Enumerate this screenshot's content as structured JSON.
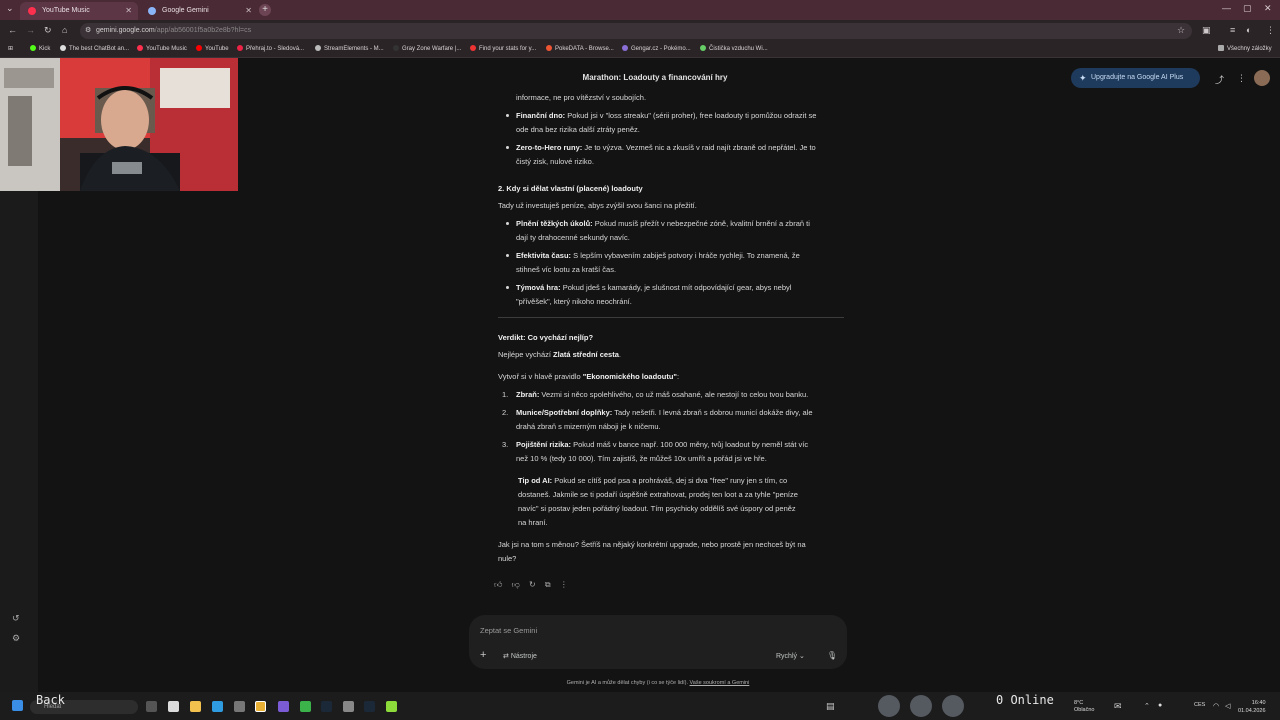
{
  "tabs": [
    {
      "label": "YouTube Music",
      "active": true
    },
    {
      "label": "Google Gemini",
      "active": false
    }
  ],
  "address": {
    "domain": "gemini.google.com",
    "path": "/app/ab56001f5a0b2e8b?hl=cs"
  },
  "bookmarks": [
    {
      "label": "Kick"
    },
    {
      "label": "The best ChatBot an..."
    },
    {
      "label": "YouTube Music"
    },
    {
      "label": "YouTube"
    },
    {
      "label": "Přehraj.to - Sledová..."
    },
    {
      "label": "StreamElements - M..."
    },
    {
      "label": "Gray Zone Warfare |..."
    },
    {
      "label": "Find your stats for y..."
    },
    {
      "label": "PokeDATA - Browse..."
    },
    {
      "label": "Gengar.cz - Pokémo..."
    },
    {
      "label": "Čistička vzduchu Wi..."
    }
  ],
  "bookmarks_all": "Všechny záložky",
  "header": {
    "title": "Marathon: Loadouty a financování hry",
    "upgrade_label": "Upgradujte na Google AI Plus"
  },
  "content": {
    "line_intro": "informace, ne pro vítězství v soubojích.",
    "b1_term": "Finanční dno:",
    "b1_text": " Pokud jsi v \"loss streaku\" (sérii proher), free loadouty ti pomůžou odrazit se",
    "b1_text2": "ode dna bez rizika další ztráty peněz.",
    "b2_term": "Zero-to-Hero runy:",
    "b2_text": " Je to výzva. Vezmeš nic a zkusíš v raid najít zbraně od nepřátel. Je to",
    "b2_text2": "čistý zisk, nulové riziko.",
    "h2": "2. Kdy si dělat vlastní (placené) loadouty",
    "h2_intro": "Tady už investuješ peníze, abys zvýšil svou šanci na přežití.",
    "b3_term": "Plnění těžkých úkolů:",
    "b3_text": " Pokud musíš přežít v nebezpečné zóně, kvalitní brnění a zbraň ti",
    "b3_text2": "dají ty drahocenné sekundy navíc.",
    "b4_term": "Efektivita času:",
    "b4_text": " S lepším vybavením zabiješ potvory i hráče rychleji. To znamená, že",
    "b4_text2": "stihneš víc lootu za kratší čas.",
    "b5_term": "Týmová hra:",
    "b5_text": " Pokud jdeš s kamarády, je slušnost mít odpovídající gear, abys nebyl",
    "b5_text2": "\"přívěšek\", který nikoho neochrání.",
    "verdict_title": "Verdikt: Co vychází nejlíp?",
    "verdict_pre": "Nejlépe vychází ",
    "verdict_bold": "Zlatá střední cesta",
    "verdict_post": ".",
    "rule_pre": "Vytvoř si v hlavě pravidlo ",
    "rule_bold": "\"Ekonomického loadoutu\"",
    "rule_post": ":",
    "n1_num": "1.",
    "n1_term": "Zbraň:",
    "n1_text": " Vezmi si něco spolehlivého, co už máš osahané, ale nestojí to celou tvou banku.",
    "n2_num": "2.",
    "n2_term": "Munice/Spotřební doplňky:",
    "n2_text": " Tady nešetři. I levná zbraň s dobrou municí dokáže divy, ale",
    "n2_text2": "drahá zbraň s mizerným náboji je k ničemu.",
    "n3_num": "3.",
    "n3_term": "Pojištění rizika:",
    "n3_text": " Pokud máš v bance např. 100 000 měny, tvůj loadout by neměl stát víc",
    "n3_text2": "než 10 % (tedy 10 000). Tím zajistíš, že můžeš 10x umřít a pořád jsi ve hře.",
    "tip_term": "Tip od AI:",
    "tip_text": " Pokud se cítíš pod psa a prohráváš, dej si dva \"free\" runy jen s tím, co",
    "tip_text2": "dostaneš. Jakmile se ti podaří úspěšně extrahovat, prodej ten loot a za tyhle \"peníze",
    "tip_text3": "navíc\" si postav jeden pořádný loadout. Tím psychicky oddělíš své úspory od peněz",
    "tip_text4": "na hraní.",
    "question": "Jak jsi na tom s měnou? Šetříš na nějaký konkrétní upgrade, nebo prostě jen nechceš být na",
    "question2": "nule?"
  },
  "prompt": {
    "placeholder": "Zeptat se Gemini",
    "tools_label": "Nástroje",
    "mode_label": "Rychlý"
  },
  "disclaimer": {
    "text": "Gemini je AI a může dělat chyby (i co se týče lidí). ",
    "link": "Vaše soukromí a Gemini"
  },
  "taskbar": {
    "search_placeholder": "Hledat",
    "overlay_back": "Back",
    "overlay_online": "0 Online",
    "weather_temp": "8°C",
    "weather_text": "Oblačno",
    "lang": "CES",
    "time": "16:40",
    "date": "01.04.2026"
  }
}
